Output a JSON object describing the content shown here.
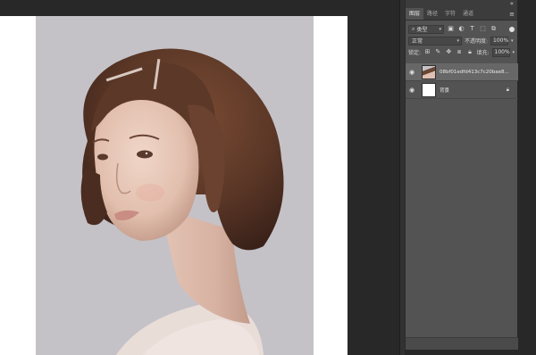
{
  "layers_panel": {
    "tabs": [
      {
        "label": "图层",
        "active": true
      },
      {
        "label": "路径",
        "active": false
      },
      {
        "label": "字符",
        "active": false
      },
      {
        "label": "通道",
        "active": false
      }
    ],
    "filter_kind": "类型",
    "blend_mode": "正常",
    "opacity_label": "不透明度:",
    "opacity_value": "100%",
    "lock_label": "锁定:",
    "fill_label": "填充:",
    "fill_value": "100%",
    "layers": [
      {
        "name": "08bf01edfd413c7c20bae8...",
        "visible": true,
        "selected": true
      },
      {
        "name": "背景",
        "visible": true,
        "selected": false,
        "locked": true
      }
    ]
  },
  "icons": {
    "eye": "eye-icon",
    "lock": "lock-icon",
    "menu": "panel-menu-icon",
    "collapse": "collapse-icon"
  },
  "colors": {
    "workspace": "#282828",
    "panel": "#535353",
    "canvas_bg": "#c4c2c7",
    "hair": "#5e3a28",
    "skin": "#e6c7b8"
  }
}
